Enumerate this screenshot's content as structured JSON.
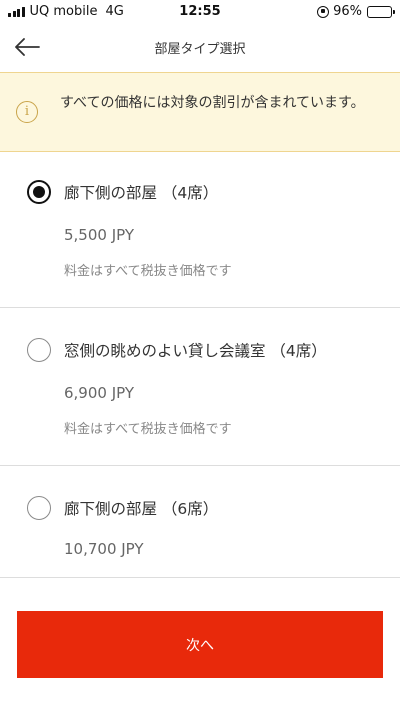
{
  "status_bar": {
    "carrier": "UQ mobile",
    "network": "4G",
    "time": "12:55",
    "battery": "96%",
    "battery_level": 0.96
  },
  "header": {
    "back_icon": "arrow-left-icon",
    "title": "部屋タイプ選択"
  },
  "notice": {
    "icon": "info-icon",
    "text": "すべての価格には対象の割引が含まれています。"
  },
  "rooms": [
    {
      "name": "廊下側の部屋 （4席）",
      "price": "5,500 JPY",
      "note": "料金はすべて税抜き価格です",
      "selected": true
    },
    {
      "name": "窓側の眺めのよい貸し会議室 （4席）",
      "price": "6,900 JPY",
      "note": "料金はすべて税抜き価格です",
      "selected": false
    },
    {
      "name": "廊下側の部屋 （6席）",
      "price": "10,700 JPY",
      "note": "",
      "selected": false
    }
  ],
  "footer": {
    "next_label": "次へ"
  },
  "colors": {
    "accent": "#e8290b",
    "notice_bg": "#fdf7dd",
    "notice_border": "#efd590",
    "notice_icon": "#c9a44a"
  }
}
